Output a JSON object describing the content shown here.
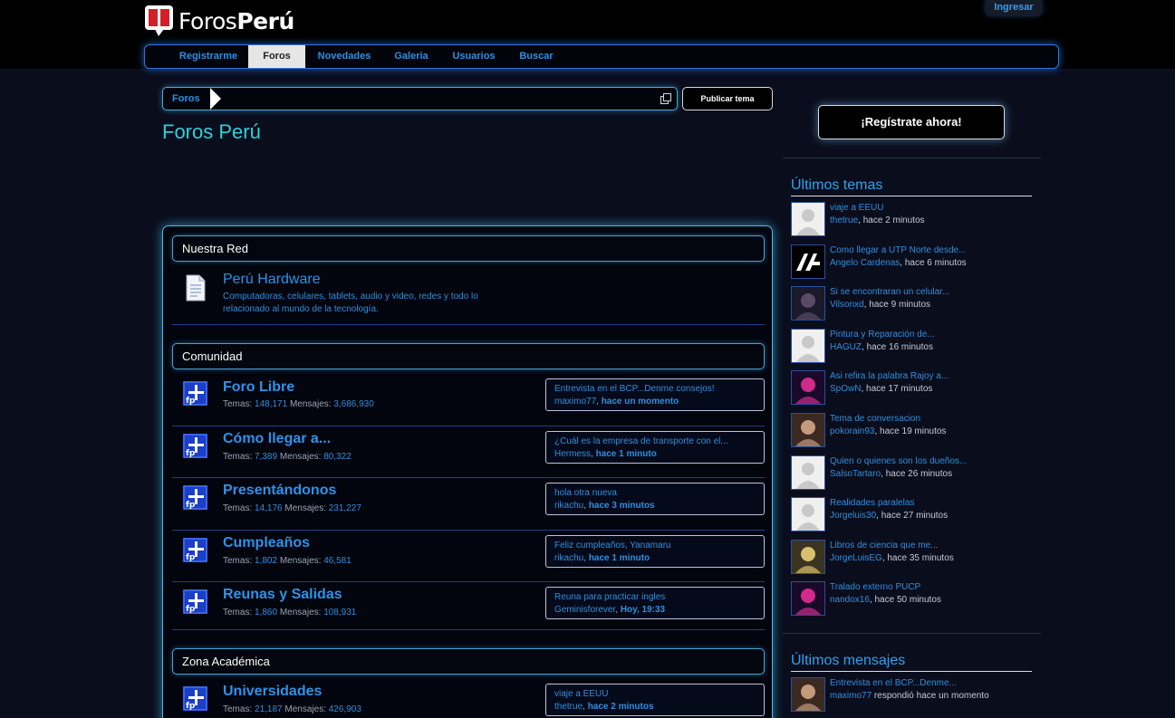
{
  "header": {
    "logo_part1": "Foros",
    "logo_part2": "Perú",
    "login_label": "Ingresar"
  },
  "nav": {
    "items": [
      {
        "label": "Registrarme",
        "active": false
      },
      {
        "label": "Foros",
        "active": true
      },
      {
        "label": "Novedades",
        "active": false
      },
      {
        "label": "Galeria",
        "active": false
      },
      {
        "label": "Usuarios",
        "active": false
      },
      {
        "label": "Buscar",
        "active": false
      }
    ]
  },
  "breadcrumb": {
    "root": "Foros"
  },
  "publish_label": "Publicar tema",
  "page_title": "Foros Perú",
  "categories": [
    {
      "title": "Nuestra Red"
    },
    {
      "title": "Comunidad"
    },
    {
      "title": "Zona Académica"
    }
  ],
  "network_forum": {
    "name": "Perú Hardware",
    "desc_line1": "Computadoras, celulares, tablets, audio y video, redes y todo lo",
    "desc_line2": "relacionado al mundo de la tecnología."
  },
  "stats_labels": {
    "threads": "Temas:",
    "posts": "Mensajes:"
  },
  "forums": [
    {
      "name": "Foro Libre",
      "threads": "148,171",
      "posts": "3,686,930",
      "last_title": "Entrevista en el BCP...Denme consejos!",
      "last_user": "maximo77",
      "last_time": "hace un momento"
    },
    {
      "name": "Cómo llegar a...",
      "threads": "7,389",
      "posts": "80,322",
      "last_title": "¿Cuál es la empresa de transporte con el...",
      "last_user": "Hermess",
      "last_time": "hace 1 minuto"
    },
    {
      "name": "Presentándonos",
      "threads": "14,176",
      "posts": "231,227",
      "last_title": "hola otra nueva",
      "last_user": "rikachu",
      "last_time": "hace 3 minutos"
    },
    {
      "name": "Cumpleaños",
      "threads": "1,802",
      "posts": "46,581",
      "last_title": "Feliz cumpleaños, Yanamaru",
      "last_user": "rikachu",
      "last_time": "hace 1 minuto"
    },
    {
      "name": "Reunas y Salidas",
      "threads": "1,860",
      "posts": "108,931",
      "last_title": "Reuna para practicar ingles",
      "last_user": "Geminisforever",
      "last_time": "Hoy, 19:33"
    },
    {
      "name": "Universidades",
      "threads": "21,187",
      "posts": "426,903",
      "last_title": "viaje a EEUU",
      "last_user": "thetrue",
      "last_time": "hace 2 minutos"
    }
  ],
  "sidebar": {
    "register_label": "¡Regístrate ahora!",
    "latest_topics_title": "Últimos temas",
    "latest_posts_title": "Últimos mensajes",
    "topics": [
      {
        "title": "viaje a EEUU",
        "user": "thetrue",
        "time": "hace 2 minutos",
        "avatar": "default"
      },
      {
        "title": "Como llegar a UTP Norte desde...",
        "user": "Angelo Cardenas",
        "time": "hace 6 minutos",
        "avatar": "logo"
      },
      {
        "title": "Si se encontraran un celular...",
        "user": "Vilsonxd",
        "time": "hace 9 minutos",
        "avatar": "photo"
      },
      {
        "title": "Pintura y Reparación de...",
        "user": "HAGUZ",
        "time": "hace 16 minutos",
        "avatar": "default"
      },
      {
        "title": "Asi refira la palabra Rajoy a...",
        "user": "SpOwN",
        "time": "hace 17 minutos",
        "avatar": "photo"
      },
      {
        "title": "Tema de conversacion",
        "user": "pokorain93",
        "time": "hace 19 minutos",
        "avatar": "photo"
      },
      {
        "title": "Quien o quienes son los dueños...",
        "user": "SalsoTartaro",
        "time": "hace 26 minutos",
        "avatar": "default"
      },
      {
        "title": "Realidades paralelas",
        "user": "Jorgeluis30",
        "time": "hace 27 minutos",
        "avatar": "default"
      },
      {
        "title": "Libros de ciencia que me...",
        "user": "JorgeLuisEG",
        "time": "hace 35 minutos",
        "avatar": "photo"
      },
      {
        "title": "Tralado externo PUCP",
        "user": "nandox16",
        "time": "hace 50 minutos",
        "avatar": "photo"
      }
    ],
    "posts": [
      {
        "title": "Entrevista en el BCP...Denme...",
        "user": "maximo77",
        "time": "respondió hace un momento",
        "avatar": "photo"
      }
    ]
  },
  "colors": {
    "accent": "#2e8fe0",
    "title_cyan": "#2cd2d8",
    "glow": "#4ab8e6"
  }
}
